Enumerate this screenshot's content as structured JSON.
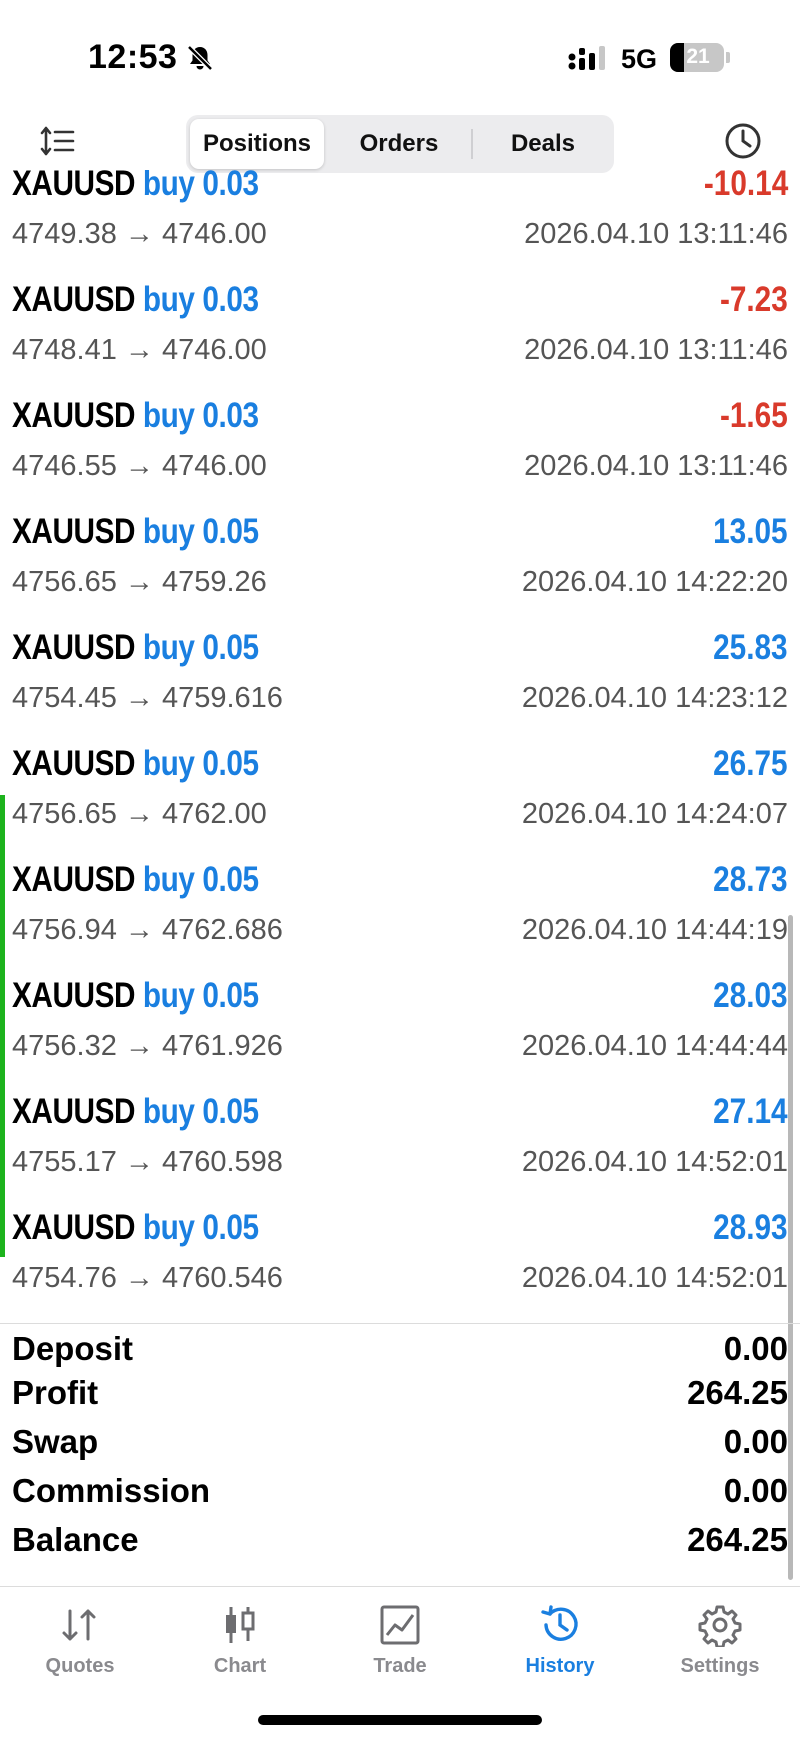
{
  "status_bar": {
    "time": "12:53",
    "network": "5G",
    "battery": "21"
  },
  "toolbar": {
    "segments": [
      {
        "label": "Positions",
        "active": true
      },
      {
        "label": "Orders",
        "active": false
      },
      {
        "label": "Deals",
        "active": false
      }
    ]
  },
  "colors": {
    "accent": "#1a7fe0",
    "loss": "#d93a2b",
    "gain": "#1a7fe0",
    "indicator": "#1db31d"
  },
  "deals": [
    {
      "symbol": "XAUUSD",
      "side": "buy 0.03",
      "prices": "4749.38 → 4746.00",
      "time": "2026.04.10 13:11:46",
      "profit": "-10.14",
      "loss": true
    },
    {
      "symbol": "XAUUSD",
      "side": "buy 0.03",
      "prices": "4748.41 → 4746.00",
      "time": "2026.04.10 13:11:46",
      "profit": "-7.23",
      "loss": true
    },
    {
      "symbol": "XAUUSD",
      "side": "buy 0.03",
      "prices": "4746.55 → 4746.00",
      "time": "2026.04.10 13:11:46",
      "profit": "-1.65",
      "loss": true
    },
    {
      "symbol": "XAUUSD",
      "side": "buy 0.05",
      "prices": "4756.65 → 4759.26",
      "time": "2026.04.10 14:22:20",
      "profit": "13.05",
      "loss": false
    },
    {
      "symbol": "XAUUSD",
      "side": "buy 0.05",
      "prices": "4754.45 → 4759.616",
      "time": "2026.04.10 14:23:12",
      "profit": "25.83",
      "loss": false
    },
    {
      "symbol": "XAUUSD",
      "side": "buy 0.05",
      "prices": "4756.65 → 4762.00",
      "time": "2026.04.10 14:24:07",
      "profit": "26.75",
      "loss": false
    },
    {
      "symbol": "XAUUSD",
      "side": "buy 0.05",
      "prices": "4756.94 → 4762.686",
      "time": "2026.04.10 14:44:19",
      "profit": "28.73",
      "loss": false
    },
    {
      "symbol": "XAUUSD",
      "side": "buy 0.05",
      "prices": "4756.32 → 4761.926",
      "time": "2026.04.10 14:44:44",
      "profit": "28.03",
      "loss": false
    },
    {
      "symbol": "XAUUSD",
      "side": "buy 0.05",
      "prices": "4755.17 → 4760.598",
      "time": "2026.04.10 14:52:01",
      "profit": "27.14",
      "loss": false
    },
    {
      "symbol": "XAUUSD",
      "side": "buy 0.05",
      "prices": "4754.76 → 4760.546",
      "time": "2026.04.10 14:52:01",
      "profit": "28.93",
      "loss": false
    }
  ],
  "summary": [
    {
      "label": "Deposit",
      "value": "0.00"
    },
    {
      "label": "Profit",
      "value": "264.25"
    },
    {
      "label": "Swap",
      "value": "0.00"
    },
    {
      "label": "Commission",
      "value": "0.00"
    },
    {
      "label": "Balance",
      "value": "264.25"
    }
  ],
  "tabs": [
    {
      "label": "Quotes",
      "icon": "quotes-icon",
      "active": false
    },
    {
      "label": "Chart",
      "icon": "chart-icon",
      "active": false
    },
    {
      "label": "Trade",
      "icon": "trade-icon",
      "active": false
    },
    {
      "label": "History",
      "icon": "history-icon",
      "active": true
    },
    {
      "label": "Settings",
      "icon": "settings-icon",
      "active": false
    }
  ]
}
